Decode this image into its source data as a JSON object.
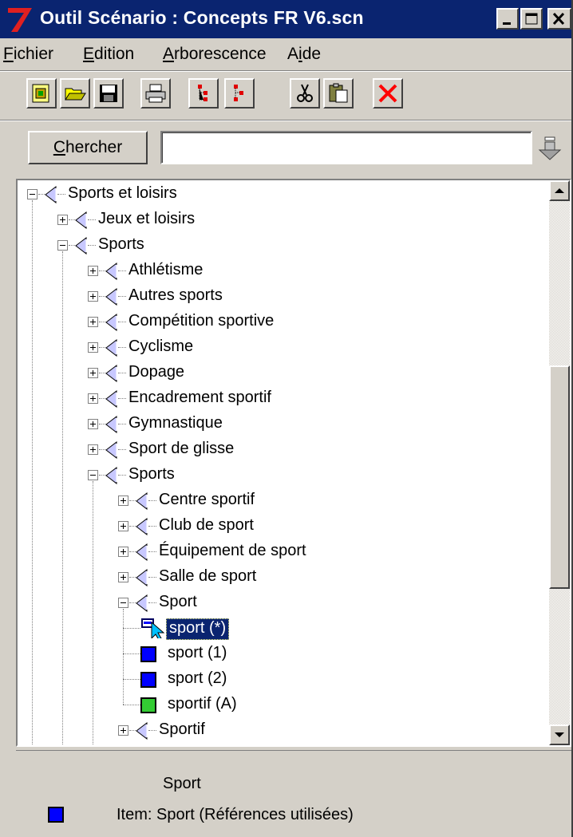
{
  "window": {
    "title": "Outil Scénario : Concepts FR V6.scn",
    "app_icon": "red-seven-icon",
    "controls": [
      "minimize-icon",
      "maximize-icon",
      "close-icon"
    ]
  },
  "menu": [
    {
      "label": "Fichier",
      "accel": "F",
      "rest": "ichier"
    },
    {
      "label": "Edition",
      "accel": "E",
      "rest": "dition"
    },
    {
      "label": "Arborescence",
      "accel": "A",
      "rest": "rborescence"
    },
    {
      "label": "Aide",
      "pre": "A",
      "accel": "i",
      "rest": "de"
    }
  ],
  "toolbar": [
    "new-icon",
    "open-icon",
    "save-icon",
    "print-icon",
    "tree-expand-icon",
    "tree-collapse-icon",
    "cut-icon",
    "paste-icon",
    "delete-icon"
  ],
  "search": {
    "button_accel": "C",
    "button_rest": "hercher",
    "input_value": "",
    "arrow_icon": "down-arrow-icon"
  },
  "tree": {
    "nodes": [
      {
        "label": "Sports et loisirs",
        "level": 0,
        "type": "folder",
        "expanded": true
      },
      {
        "label": "Jeux et loisirs",
        "level": 1,
        "type": "folder",
        "expanded": false
      },
      {
        "label": "Sports",
        "level": 1,
        "type": "folder",
        "expanded": true
      },
      {
        "label": "Athlétisme",
        "level": 2,
        "type": "folder",
        "expanded": false
      },
      {
        "label": "Autres sports",
        "level": 2,
        "type": "folder",
        "expanded": false
      },
      {
        "label": "Compétition sportive",
        "level": 2,
        "type": "folder",
        "expanded": false
      },
      {
        "label": "Cyclisme",
        "level": 2,
        "type": "folder",
        "expanded": false
      },
      {
        "label": "Dopage",
        "level": 2,
        "type": "folder",
        "expanded": false
      },
      {
        "label": "Encadrement sportif",
        "level": 2,
        "type": "folder",
        "expanded": false
      },
      {
        "label": "Gymnastique",
        "level": 2,
        "type": "folder",
        "expanded": false
      },
      {
        "label": "Sport de glisse",
        "level": 2,
        "type": "folder",
        "expanded": false
      },
      {
        "label": "Sports",
        "level": 2,
        "type": "folder",
        "expanded": true
      },
      {
        "label": "Centre sportif",
        "level": 3,
        "type": "folder",
        "expanded": false
      },
      {
        "label": "Club de sport",
        "level": 3,
        "type": "folder",
        "expanded": false
      },
      {
        "label": "Équipement de sport",
        "level": 3,
        "type": "folder",
        "expanded": false
      },
      {
        "label": "Salle de sport",
        "level": 3,
        "type": "folder",
        "expanded": false
      },
      {
        "label": "Sport",
        "level": 3,
        "type": "folder",
        "expanded": true
      },
      {
        "label": "sport (*)",
        "level": 4,
        "type": "item-selected",
        "color": "#0000ff"
      },
      {
        "label": "sport (1)",
        "level": 4,
        "type": "item",
        "color": "#0000ff"
      },
      {
        "label": "sport (2)",
        "level": 4,
        "type": "item",
        "color": "#0000ff"
      },
      {
        "label": "sportif (A)",
        "level": 4,
        "type": "item",
        "color": "#33cc33"
      },
      {
        "label": "Sportif",
        "level": 3,
        "type": "folder",
        "expanded": false
      }
    ]
  },
  "status": {
    "title": "Sport",
    "item_text": "Item: Sport (Références utilisées)",
    "item_color": "#0000ff"
  },
  "colors": {
    "titlebar": "#0a2470",
    "face": "#d4d0c8",
    "folder_triangle": "#c8c8ff",
    "item_blue": "#0000ff",
    "item_green": "#33cc33"
  }
}
